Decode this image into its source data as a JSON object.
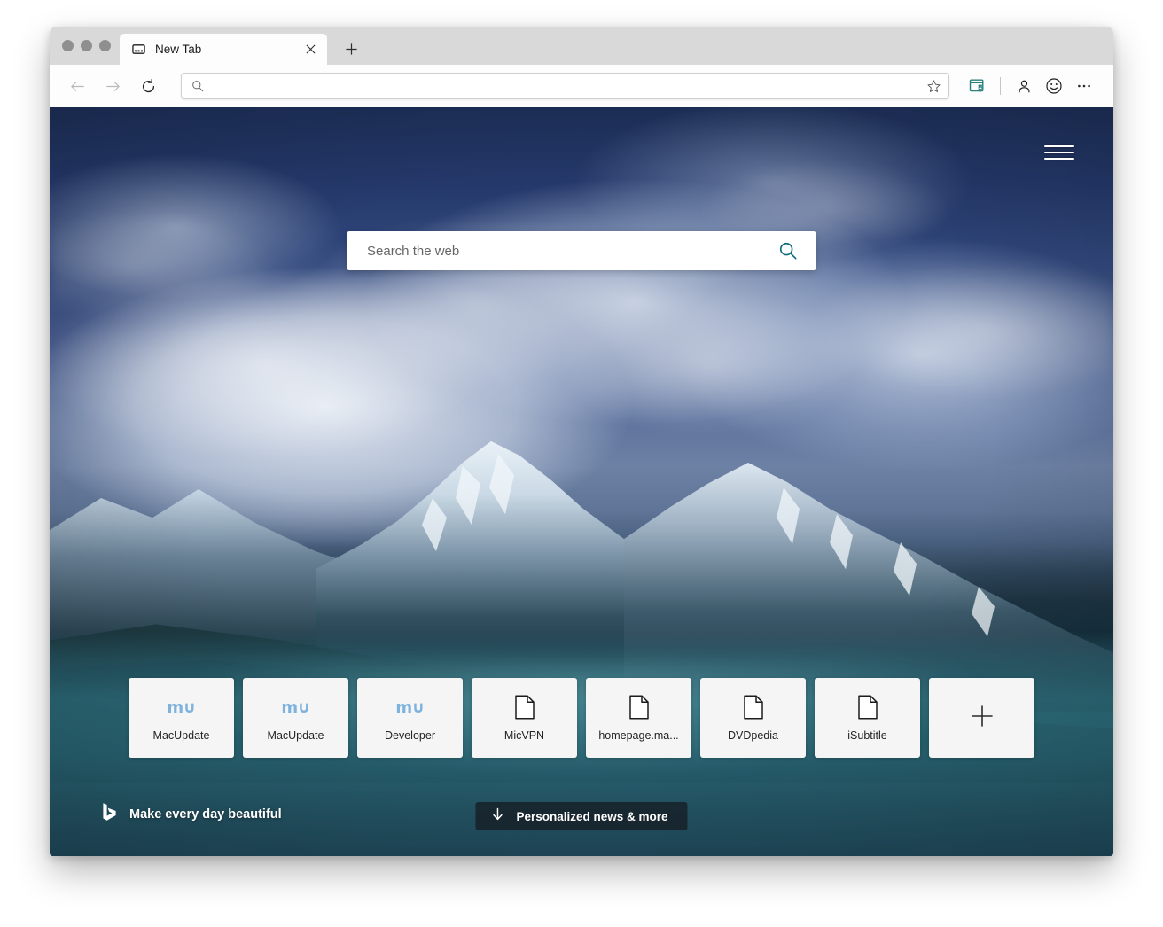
{
  "window": {
    "traffic_lights": [
      "close",
      "minimize",
      "zoom"
    ]
  },
  "tabs": {
    "items": [
      {
        "title": "New Tab",
        "favicon": "new-tab-page-icon",
        "close_label": "✕"
      }
    ],
    "new_tab_label": "+"
  },
  "toolbar": {
    "back_label": "←",
    "forward_label": "→",
    "reload_label": "↻",
    "address": {
      "value": "",
      "placeholder": "",
      "search_icon": "search-icon",
      "favorite_icon": "star-icon"
    },
    "collections_icon": "collections-icon",
    "profile_icon": "person-icon",
    "feedback_icon": "smiley-icon",
    "more_icon": "ellipsis-icon",
    "collections_color": "#2a7f80"
  },
  "newtab": {
    "menu_icon": "hamburger-menu-icon",
    "search": {
      "value": "",
      "placeholder": "Search the web",
      "button_icon": "search-icon",
      "accent_color": "#0e6b80"
    },
    "tiles": [
      {
        "label": "MacUpdate",
        "icon": "macupdate-logo-icon",
        "logo_text": "m∪"
      },
      {
        "label": "MacUpdate",
        "icon": "macupdate-logo-icon",
        "logo_text": "m∪"
      },
      {
        "label": "Developer",
        "icon": "macupdate-logo-icon",
        "logo_text": "m∪"
      },
      {
        "label": "MicVPN",
        "icon": "page-document-icon",
        "logo_text": ""
      },
      {
        "label": "homepage.ma...",
        "icon": "page-document-icon",
        "logo_text": ""
      },
      {
        "label": "DVDpedia",
        "icon": "page-document-icon",
        "logo_text": ""
      },
      {
        "label": "iSubtitle",
        "icon": "page-document-icon",
        "logo_text": ""
      }
    ],
    "add_tile": {
      "label": "+",
      "icon": "plus-icon"
    },
    "brand": {
      "logo": "bing-logo-icon",
      "tagline": "Make every day beautiful"
    },
    "news_button": {
      "label": "Personalized news & more",
      "icon": "down-arrow-icon"
    },
    "background": {
      "description": "snow-capped-mountains-glacial-lake-photo",
      "sky_color": "#24386a",
      "lake_color": "#2a6272"
    }
  }
}
